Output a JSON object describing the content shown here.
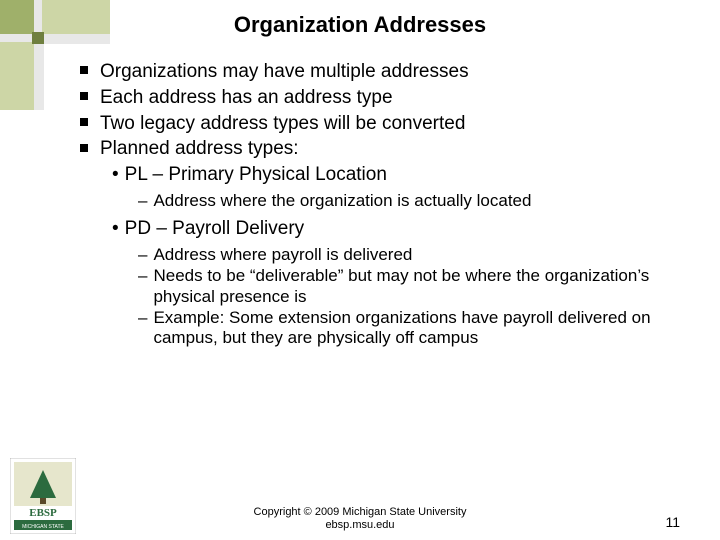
{
  "title": "Organization Addresses",
  "bullets": [
    "Organizations may have multiple addresses",
    "Each address has an address type",
    "Two legacy address types will be converted",
    "Planned address types:"
  ],
  "subA": {
    "heading": "PL – Primary Physical Location",
    "items": [
      "Address where the organization is actually located"
    ]
  },
  "subB": {
    "heading": "PD – Payroll Delivery",
    "items": [
      "Address where payroll is delivered",
      "Needs to be “deliverable” but may not be where the organization’s physical presence is",
      "Example:  Some extension organizations have payroll delivered on campus, but they are physically off campus"
    ]
  },
  "footer": {
    "line1": "Copyright © 2009 Michigan State University",
    "line2": "ebsp.msu.edu"
  },
  "page_number": "11",
  "logo_alt": "EBSP Michigan State University"
}
